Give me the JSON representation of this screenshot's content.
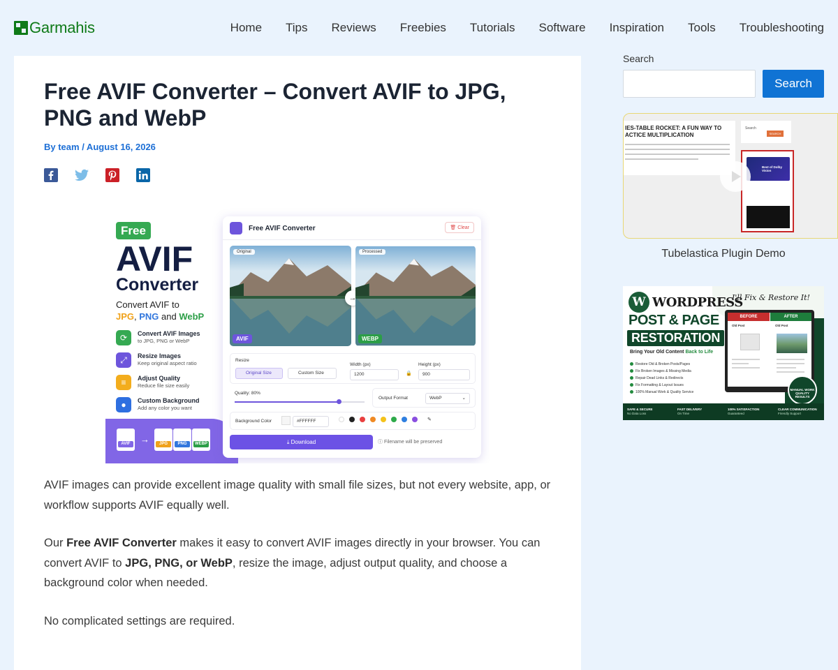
{
  "header": {
    "logo_text": "Garmahis",
    "nav": [
      "Home",
      "Tips",
      "Reviews",
      "Freebies",
      "Tutorials",
      "Software",
      "Inspiration",
      "Tools",
      "Troubleshooting"
    ]
  },
  "article": {
    "title": "Free AVIF Converter – Convert AVIF to JPG, PNG and WebP",
    "meta": "By team / August 16, 2026",
    "share": [
      "facebook",
      "twitter",
      "pinterest",
      "linkedin"
    ],
    "paragraphs": {
      "p1": "AVIF images can provide excellent image quality with small file sizes, but not every website, app, or workflow supports AVIF equally well.",
      "p2_a": "Our ",
      "p2_b": "Free AVIF Converter",
      "p2_c": " makes it easy to convert AVIF images directly in your browser. You can convert AVIF to ",
      "p2_d": "JPG, PNG, or WebP",
      "p2_e": ", resize the image, adjust output quality, and choose a background color when needed.",
      "p3": "No complicated settings are required."
    }
  },
  "featured_image": {
    "badge": "Free",
    "headline_1": "AVIF",
    "headline_2": "Converter",
    "tagline_1": "Convert AVIF to",
    "tag_jpg": "JPG",
    "tag_sep1": ", ",
    "tag_png": "PNG",
    "tag_sep2": " and ",
    "tag_webp": "WebP",
    "features": [
      {
        "title": "Convert AVIF Images",
        "sub": "to JPG, PNG or WebP",
        "color": "#35a952"
      },
      {
        "title": "Resize Images",
        "sub": "Keep original aspect ratio",
        "color": "#6d55dc"
      },
      {
        "title": "Adjust Quality",
        "sub": "Reduce file size easily",
        "color": "#f3ad1d"
      },
      {
        "title": "Custom Background",
        "sub": "Add any color you want",
        "color": "#2e6fe0"
      }
    ],
    "file_labels": [
      "AVIF",
      "JPG",
      "PNG",
      "WEBP"
    ],
    "panel": {
      "title": "Free AVIF Converter",
      "clear": "Clear",
      "original": "Original",
      "processed": "Processed",
      "format_in": "AVIF",
      "format_out": "WEBP",
      "resize": "Resize",
      "original_size": "Original Size",
      "custom_size": "Custom Size",
      "width_label": "Width (px)",
      "width_value": "1200",
      "height_label": "Height (px)",
      "height_value": "900",
      "quality_label": "Quality: 80%",
      "quality_value": 0.8,
      "output_format_label": "Output Format",
      "output_format_value": "WebP",
      "bg_label": "Background Color",
      "bg_value": "#FFFFFF",
      "swatches": [
        "#ffffff",
        "#222222",
        "#e94040",
        "#f08a24",
        "#f4c21b",
        "#2eaa4a",
        "#2f7fe0",
        "#8a4fe0"
      ],
      "download": "Download",
      "note": "Filename will be preserved"
    }
  },
  "sidebar": {
    "search_label": "Search",
    "search_placeholder": "",
    "search_button": "Search",
    "demo": {
      "card_title": "IES-TABLE ROCKET: A FUN WAY TO ACTICE MULTIPLICATION",
      "side_search": "Search",
      "side_button": "SEARCH",
      "ad_text": "Best of Dolby Vision",
      "caption": "Tubelastica Plugin Demo"
    },
    "promo": {
      "wp_letter": "W",
      "wp_word": "WORDPRESS",
      "line1": "POST & PAGE",
      "line2": "RESTORATION",
      "sub_a": "Bring Your Old Content ",
      "sub_b": "Back to Life",
      "handwritten": "I'll Fix & Restore It!",
      "list": [
        "Restore Old & Broken Posts/Pages",
        "Fix Broken Images & Missing Media",
        "Repair Dead Links & Redirects",
        "Fix Formatting & Layout Issues",
        "100% Manual Work & Quality Service"
      ],
      "before": "BEFORE",
      "after": "AFTER",
      "old_post_1": "Old Post",
      "old_post_2": "Old Post",
      "seal": "MANUAL WORK QUALITY RESULTS",
      "footer": [
        {
          "t": "SAFE & SECURE",
          "s": "No Data Loss"
        },
        {
          "t": "FAST DELIVERY",
          "s": "On Time"
        },
        {
          "t": "100% SATISFACTION",
          "s": "Guaranteed"
        },
        {
          "t": "CLEAR COMMUNICATION",
          "s": "Friendly Support"
        }
      ]
    }
  }
}
